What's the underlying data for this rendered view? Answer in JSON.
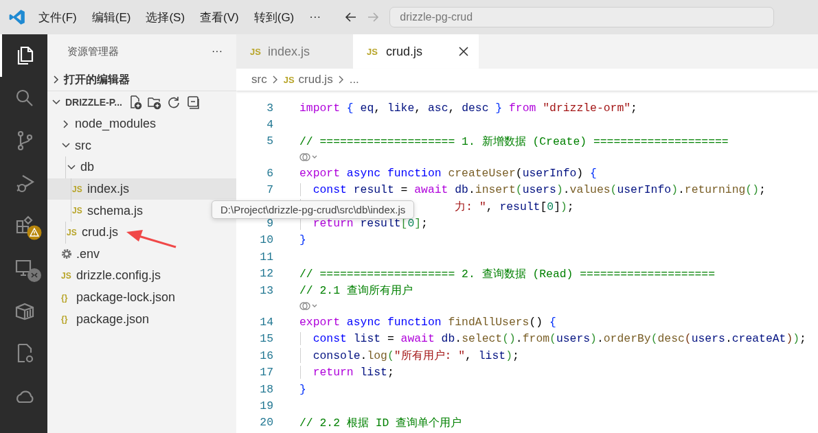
{
  "menu": [
    "文件(F)",
    "编辑(E)",
    "选择(S)",
    "查看(V)",
    "转到(G)",
    "···"
  ],
  "command_center": {
    "placeholder": "drizzle-pg-crud"
  },
  "activity_bar": [
    {
      "kind": "files",
      "selected": true
    },
    {
      "kind": "search",
      "selected": false
    },
    {
      "kind": "branch",
      "selected": false
    },
    {
      "kind": "debug",
      "selected": false
    },
    {
      "kind": "extensions",
      "selected": false,
      "warning": true
    },
    {
      "kind": "remote",
      "selected": false
    },
    {
      "kind": "box",
      "selected": false
    },
    {
      "kind": "gearfile",
      "selected": false
    },
    {
      "kind": "cloud",
      "selected": false
    }
  ],
  "sidebar": {
    "title": "资源管理器",
    "more": "···",
    "open_editors": {
      "label": "打开的编辑器",
      "expanded": false
    },
    "project": {
      "label": "DRIZZLE-P...",
      "expanded": true,
      "tree": [
        {
          "label": "node_modules",
          "kind": "folder",
          "expanded": false,
          "selected": false
        },
        {
          "label": "src",
          "kind": "folder",
          "expanded": true,
          "selected": false,
          "children": [
            {
              "label": "db",
              "kind": "folder",
              "expanded": true,
              "selected": false,
              "children": [
                {
                  "label": "index.js",
                  "kind": "js",
                  "badge": "JS",
                  "selected": true
                },
                {
                  "label": "schema.js",
                  "kind": "js",
                  "badge": "JS",
                  "selected": false
                }
              ]
            },
            {
              "label": "crud.js",
              "kind": "js",
              "badge": "JS",
              "selected": false
            }
          ]
        },
        {
          "label": ".env",
          "kind": "env",
          "selected": false
        },
        {
          "label": "drizzle.config.js",
          "kind": "js",
          "badge": "JS",
          "selected": false
        },
        {
          "label": "package-lock.json",
          "kind": "json",
          "badge": "{}",
          "selected": false
        },
        {
          "label": "package.json",
          "kind": "json",
          "badge": "{}",
          "selected": false
        }
      ]
    }
  },
  "tabs": [
    {
      "label": "index.js",
      "badge": "JS",
      "selected": false
    },
    {
      "label": "crud.js",
      "badge": "JS",
      "selected": true
    }
  ],
  "breadcrumb": [
    {
      "label": "src"
    },
    {
      "label": "crud.js",
      "badge": "JS"
    },
    {
      "label": "..."
    }
  ],
  "tooltip": "D:\\Project\\drizzle-pg-crud\\src\\db\\index.js",
  "code": [
    {
      "kind": "code",
      "number": "3",
      "tokens": [
        {
          "kind": "kw",
          "text": "import "
        },
        {
          "kind": "b1",
          "text": "{"
        },
        {
          "kind": "var",
          "text": " eq"
        },
        {
          "kind": "p",
          "text": ", "
        },
        {
          "kind": "var",
          "text": "like"
        },
        {
          "kind": "p",
          "text": ", "
        },
        {
          "kind": "var",
          "text": "asc"
        },
        {
          "kind": "p",
          "text": ", "
        },
        {
          "kind": "var",
          "text": "desc "
        },
        {
          "kind": "b1",
          "text": "}"
        },
        {
          "kind": "kw",
          "text": " from "
        },
        {
          "kind": "str",
          "text": "\"drizzle-orm\""
        },
        {
          "kind": "p",
          "text": ";"
        }
      ]
    },
    {
      "kind": "code",
      "number": "4"
    },
    {
      "kind": "code",
      "number": "5",
      "tokens": [
        {
          "kind": "cmt",
          "text": "// ==================== 1. 新增数据 (Create) ===================="
        }
      ]
    },
    {
      "kind": "codelens"
    },
    {
      "kind": "code",
      "number": "6",
      "tokens": [
        {
          "kind": "kw",
          "text": "export"
        },
        {
          "kind": "st",
          "text": " async function "
        },
        {
          "kind": "fn",
          "text": "createUser"
        },
        {
          "kind": "p",
          "text": "("
        },
        {
          "kind": "var",
          "text": "userInfo"
        },
        {
          "kind": "p",
          "text": ") "
        },
        {
          "kind": "b1",
          "text": "{"
        }
      ]
    },
    {
      "kind": "code",
      "number": "7",
      "guide": true,
      "tokens": [
        {
          "kind": "st",
          "text": "const "
        },
        {
          "kind": "var",
          "text": "result"
        },
        {
          "kind": "p",
          "text": " = "
        },
        {
          "kind": "kw",
          "text": "await "
        },
        {
          "kind": "var",
          "text": "db"
        },
        {
          "kind": "p",
          "text": "."
        },
        {
          "kind": "fn",
          "text": "insert"
        },
        {
          "kind": "b2",
          "text": "("
        },
        {
          "kind": "var",
          "text": "users"
        },
        {
          "kind": "b2",
          "text": ")"
        },
        {
          "kind": "p",
          "text": "."
        },
        {
          "kind": "fn",
          "text": "values"
        },
        {
          "kind": "b2",
          "text": "("
        },
        {
          "kind": "var",
          "text": "userInfo"
        },
        {
          "kind": "b2",
          "text": ")"
        },
        {
          "kind": "p",
          "text": "."
        },
        {
          "kind": "fn",
          "text": "returning"
        },
        {
          "kind": "b2",
          "text": "()"
        },
        {
          "kind": "p",
          "text": ";"
        }
      ]
    },
    {
      "kind": "code",
      "guide": true,
      "tokens": [
        {
          "kind": "str",
          "text": "                     力: \""
        },
        {
          "kind": "p",
          "text": ", "
        },
        {
          "kind": "var",
          "text": "result"
        },
        {
          "kind": "p",
          "text": "["
        },
        {
          "kind": "num",
          "text": "0"
        },
        {
          "kind": "p",
          "text": "]"
        },
        {
          "kind": "b2",
          "text": ")"
        },
        {
          "kind": "p",
          "text": ";"
        }
      ]
    },
    {
      "kind": "code",
      "number": "9",
      "guide": true,
      "tokens": [
        {
          "kind": "kw",
          "text": "return "
        },
        {
          "kind": "var",
          "text": "result"
        },
        {
          "kind": "b2",
          "text": "["
        },
        {
          "kind": "num",
          "text": "0"
        },
        {
          "kind": "b2",
          "text": "]"
        },
        {
          "kind": "p",
          "text": ";"
        }
      ]
    },
    {
      "kind": "code",
      "number": "10",
      "tokens": [
        {
          "kind": "b1",
          "text": "}"
        }
      ]
    },
    {
      "kind": "code",
      "number": "11"
    },
    {
      "kind": "code",
      "number": "12",
      "tokens": [
        {
          "kind": "cmt",
          "text": "// ==================== 2. 查询数据 (Read) ===================="
        }
      ]
    },
    {
      "kind": "code",
      "number": "13",
      "tokens": [
        {
          "kind": "cmt",
          "text": "// 2.1 查询所有用户"
        }
      ]
    },
    {
      "kind": "codelens"
    },
    {
      "kind": "code",
      "number": "14",
      "tokens": [
        {
          "kind": "kw",
          "text": "export"
        },
        {
          "kind": "st",
          "text": " async function "
        },
        {
          "kind": "fn",
          "text": "findAllUsers"
        },
        {
          "kind": "p",
          "text": "() "
        },
        {
          "kind": "b1",
          "text": "{"
        }
      ]
    },
    {
      "kind": "code",
      "number": "15",
      "guide": true,
      "tokens": [
        {
          "kind": "st",
          "text": "const "
        },
        {
          "kind": "var",
          "text": "list"
        },
        {
          "kind": "p",
          "text": " = "
        },
        {
          "kind": "kw",
          "text": "await "
        },
        {
          "kind": "var",
          "text": "db"
        },
        {
          "kind": "p",
          "text": "."
        },
        {
          "kind": "fn",
          "text": "select"
        },
        {
          "kind": "b2",
          "text": "()"
        },
        {
          "kind": "p",
          "text": "."
        },
        {
          "kind": "fn",
          "text": "from"
        },
        {
          "kind": "b2",
          "text": "("
        },
        {
          "kind": "var",
          "text": "users"
        },
        {
          "kind": "b2",
          "text": ")"
        },
        {
          "kind": "p",
          "text": "."
        },
        {
          "kind": "fn",
          "text": "orderBy"
        },
        {
          "kind": "b2",
          "text": "("
        },
        {
          "kind": "fn",
          "text": "desc"
        },
        {
          "kind": "b3",
          "text": "("
        },
        {
          "kind": "var",
          "text": "users"
        },
        {
          "kind": "p",
          "text": "."
        },
        {
          "kind": "var",
          "text": "createAt"
        },
        {
          "kind": "b3",
          "text": ")"
        },
        {
          "kind": "b2",
          "text": ")"
        },
        {
          "kind": "p",
          "text": ";"
        }
      ]
    },
    {
      "kind": "code",
      "number": "16",
      "guide": true,
      "tokens": [
        {
          "kind": "var",
          "text": "console"
        },
        {
          "kind": "p",
          "text": "."
        },
        {
          "kind": "fn",
          "text": "log"
        },
        {
          "kind": "b2",
          "text": "("
        },
        {
          "kind": "str",
          "text": "\"所有用户: \""
        },
        {
          "kind": "p",
          "text": ", "
        },
        {
          "kind": "var",
          "text": "list"
        },
        {
          "kind": "b2",
          "text": ")"
        },
        {
          "kind": "p",
          "text": ";"
        }
      ]
    },
    {
      "kind": "code",
      "number": "17",
      "guide": true,
      "tokens": [
        {
          "kind": "kw",
          "text": "return "
        },
        {
          "kind": "var",
          "text": "list"
        },
        {
          "kind": "p",
          "text": ";"
        }
      ]
    },
    {
      "kind": "code",
      "number": "18",
      "tokens": [
        {
          "kind": "b1",
          "text": "}"
        }
      ]
    },
    {
      "kind": "code",
      "number": "19"
    },
    {
      "kind": "code",
      "number": "20",
      "tokens": [
        {
          "kind": "cmt",
          "text": "// 2.2 根据 ID 查询单个用户"
        }
      ]
    }
  ]
}
